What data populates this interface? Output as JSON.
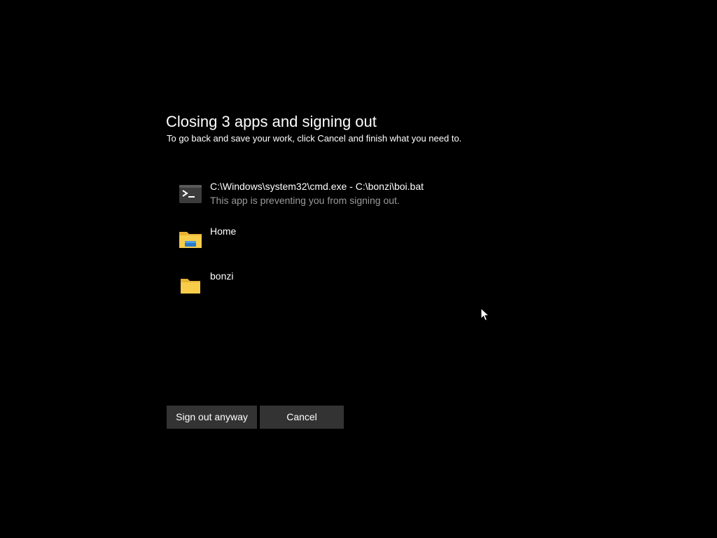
{
  "dialog": {
    "title": "Closing 3 apps and signing out",
    "subtitle": "To go back and save your work, click Cancel and finish what you need to."
  },
  "apps": [
    {
      "name": "C:\\Windows\\system32\\cmd.exe - C:\\bonzi\\boi.bat",
      "status": "This app is preventing you from signing out.",
      "icon": "terminal-icon"
    },
    {
      "name": "Home",
      "status": "",
      "icon": "home-folder-icon"
    },
    {
      "name": "bonzi",
      "status": "",
      "icon": "folder-icon"
    }
  ],
  "buttons": {
    "sign_out_label": "Sign out anyway",
    "cancel_label": "Cancel"
  },
  "colors": {
    "background": "#000000",
    "button": "#333333",
    "secondary_text": "#9a9a9a",
    "folder": "#f5c842"
  }
}
